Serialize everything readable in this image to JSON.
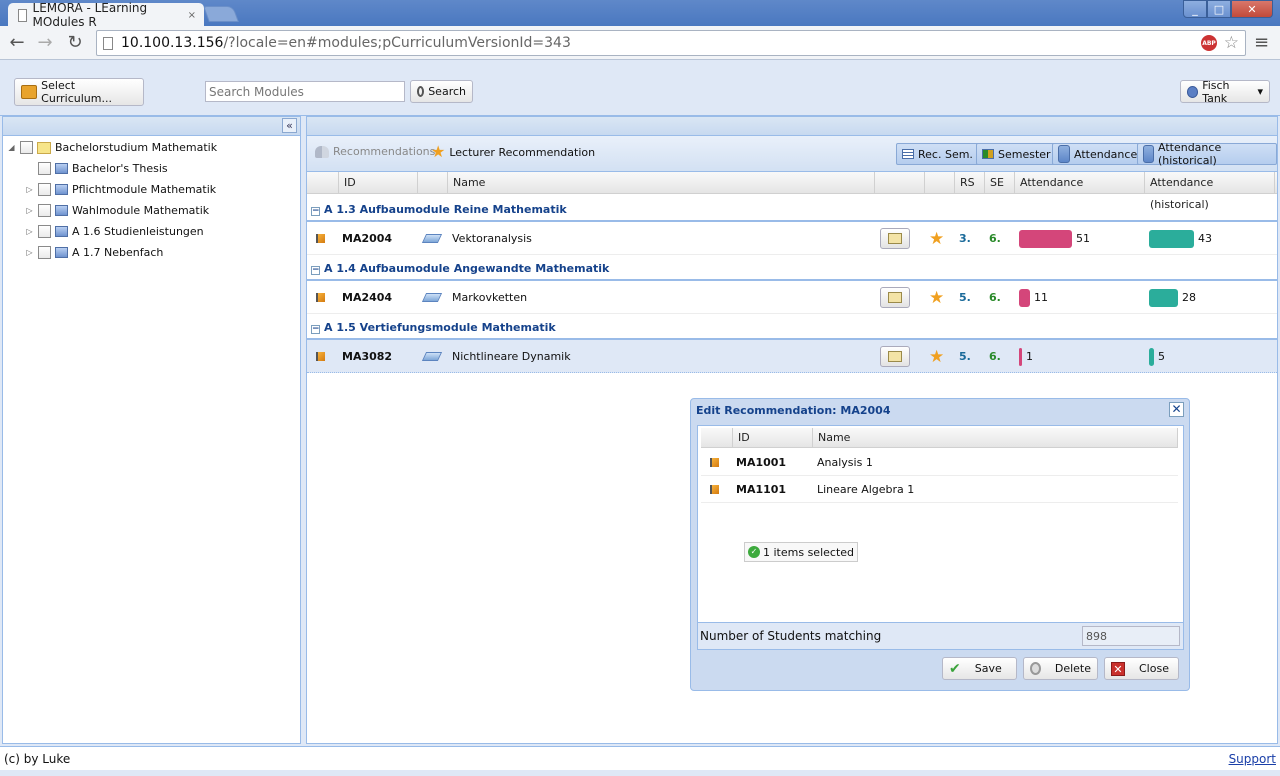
{
  "browser": {
    "tab_title": "LEMORA - LEarning MOdules R",
    "tab_close": "×",
    "url_host": "10.100.13.156",
    "url_path": "/?locale=en#modules;pCurriculumVersionId=343",
    "abp_label": "ABP",
    "win_min": "_",
    "win_max": "□",
    "win_close": "✕",
    "icons": [
      "back-arrow-icon",
      "forward-arrow-icon",
      "reload-icon",
      "star-icon",
      "menu-icon"
    ]
  },
  "toolbar": {
    "select_curriculum_label": "Select Curriculum...",
    "search_placeholder": "Search Modules",
    "search_label": "Search",
    "user_label": "Fisch Tank",
    "user_caret": "▾"
  },
  "tree": {
    "collapse_label": "«",
    "items": [
      {
        "label": "Bachelorstudium Mathematik",
        "toggle": "◢"
      },
      {
        "label": "Bachelor's Thesis",
        "toggle": ""
      },
      {
        "label": "Pflichtmodule Mathematik",
        "toggle": "▷"
      },
      {
        "label": "Wahlmodule Mathematik",
        "toggle": "▷"
      },
      {
        "label": "A 1.6 Studienleistungen",
        "toggle": "▷"
      },
      {
        "label": "A 1.7 Nebenfach",
        "toggle": "▷"
      }
    ]
  },
  "grid_toolbar": {
    "recommendations_label": "Recommendations",
    "lecturer_rec_label": "Lecturer Recommendation",
    "toggles": [
      "Rec. Sem.",
      "Semester",
      "Attendance",
      "Attendance (historical)"
    ]
  },
  "columns": {
    "id": "ID",
    "name": "Name",
    "rs": "RS",
    "se": "SE",
    "attendance": "Attendance",
    "attendance_hist": "Attendance (historical)"
  },
  "groups": [
    {
      "minus": "−",
      "title": "A 1.3 Aufbaumodule Reine Mathematik",
      "row": {
        "id": "MA2004",
        "name": "Vektoranalysis",
        "rs": "3.",
        "se": "6.",
        "attendance": 51,
        "attendance_hist": 43
      }
    },
    {
      "minus": "−",
      "title": "A 1.4 Aufbaumodule Angewandte Mathematik",
      "row": {
        "id": "MA2404",
        "name": "Markovketten",
        "rs": "5.",
        "se": "6.",
        "attendance": 11,
        "attendance_hist": 28
      }
    },
    {
      "minus": "−",
      "title": "A 1.5 Vertiefungsmodule Mathematik",
      "row": {
        "id": "MA3082",
        "name": "Nichtlineare Dynamik",
        "rs": "5.",
        "se": "6.",
        "attendance": 1,
        "attendance_hist": 5
      }
    }
  ],
  "colors": {
    "attendance_bar": "#d4467a",
    "attendance_hist_bar": "#2bad9b",
    "group_title": "#15428b"
  },
  "dialog": {
    "title": "Edit Recommendation: MA2004",
    "close_x": "✕",
    "col_id": "ID",
    "col_name": "Name",
    "rows": [
      {
        "id": "MA1001",
        "name": "Analysis 1"
      },
      {
        "id": "MA1101",
        "name": "Lineare Algebra 1"
      }
    ],
    "check_mark": "✓",
    "selected_text": "1 items selected",
    "students_label": "Number of Students matching",
    "students_value": "898",
    "ok_mark": "✔",
    "close_mark": "✕",
    "save_label": "Save",
    "delete_label": "Delete",
    "close_label": "Close"
  },
  "footer": {
    "text": "(c) by Luke",
    "support_label": "Support"
  }
}
